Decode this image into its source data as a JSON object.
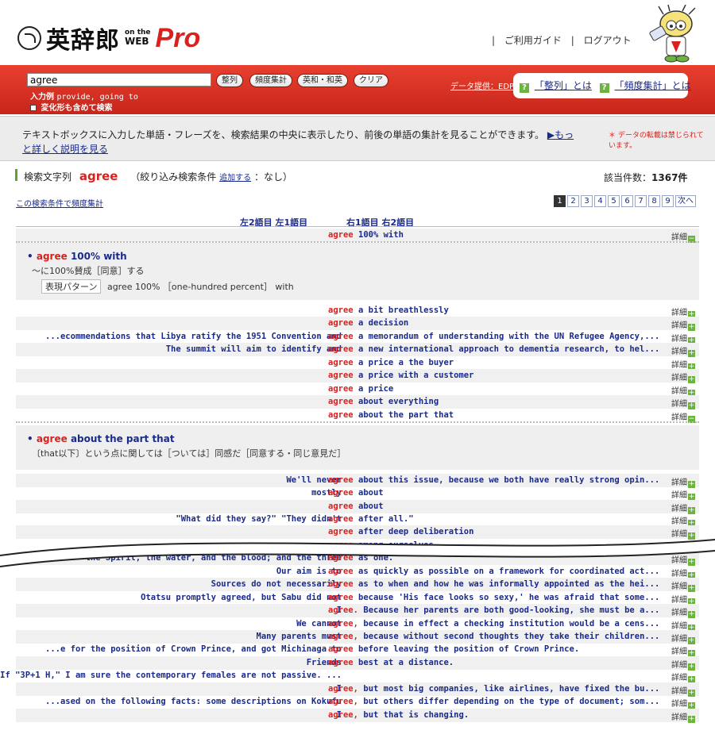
{
  "header": {
    "logo_name": "英辞郎",
    "logo_on_the": "on the",
    "logo_web": "WEB",
    "logo_pro": "Pro",
    "links": [
      "ご利用ガイド",
      "ログアウト"
    ]
  },
  "search": {
    "value": "agree",
    "buttons": [
      "整列",
      "頻度集計",
      "英和・和英",
      "クリア"
    ],
    "hint_label": "入力例",
    "hint_example": "provide, going to",
    "checkbox_label": "変化形も含めて検索",
    "data_provider": "データ提供：EDP",
    "help_links": [
      "「整列」とは",
      "「頻度集計」とは"
    ]
  },
  "info": {
    "text": "テキストボックスに入力した単語・フレーズを、検索結果の中央に表示したり、前後の単語の集計を見ることができます。",
    "more_link": "▶もっと詳しく説明を見る",
    "notice": "＊ データの転載は禁じられています。"
  },
  "results": {
    "label": "検索文字列",
    "term": "agree",
    "filter_prefix": "（絞り込み検索条件",
    "filter_link": "追加する",
    "filter_suffix": "：なし）",
    "hits_label": "該当件数：",
    "hits_value": "1367件",
    "freq_link": "この検索条件で頻度集計",
    "pages": [
      "1",
      "2",
      "3",
      "4",
      "5",
      "6",
      "7",
      "8",
      "9",
      "次へ"
    ],
    "col_left": "左2語目 左1語目",
    "col_right": "右1語目 右2語目",
    "detail_label": "詳細"
  },
  "entry1": {
    "keyword": "agree",
    "rest": "100% with",
    "meaning": "～に100%賛成［同意］する",
    "pattern_tag": "表現パターン",
    "pattern": "agree 100% ［one-hundred percent］ with"
  },
  "entry2": {
    "keyword": "agree",
    "rest": "about the part that",
    "meaning": "〔that以下〕という点に関しては［ついては］同感だ［同意する・同じ意見だ］"
  },
  "rows": [
    {
      "left": "",
      "kw": "agree",
      "right": "100% with"
    },
    {
      "left": "",
      "kw": "agree",
      "right": "a bit breathlessly"
    },
    {
      "left": "",
      "kw": "agree",
      "right": "a decision"
    },
    {
      "left": "...ecommendations that Libya ratify the 1951 Convention and",
      "kw": "agree",
      "right": "a memorandum of understanding with the UN Refugee Agency,..."
    },
    {
      "left": "The summit will aim to identify and",
      "kw": "agree",
      "right": "a new international approach to dementia research, to hel..."
    },
    {
      "left": "",
      "kw": "agree",
      "right": "a price a the buyer"
    },
    {
      "left": "",
      "kw": "agree",
      "right": "a price with a customer"
    },
    {
      "left": "",
      "kw": "agree",
      "right": "a price"
    },
    {
      "left": "",
      "kw": "agree",
      "right": "about everything"
    },
    {
      "left": "",
      "kw": "agree",
      "right": "about the part that"
    },
    {
      "left": "We'll never",
      "kw": "agree",
      "right": "about this issue, because we both have really strong opin..."
    },
    {
      "left": "mostly",
      "kw": "agree",
      "right": "about"
    },
    {
      "left": "",
      "kw": "agree",
      "right": "about"
    },
    {
      "left": "\"What did they say?\" \"They didn't",
      "kw": "agree",
      "right": "after all.\""
    },
    {
      "left": "",
      "kw": "agree",
      "right": "after deep deliberation"
    },
    {
      "left": "",
      "kw": "agree",
      "right": "among ourselves"
    },
    {
      "left": "the Spirit, the water, and the blood; and the three",
      "kw": "agree",
      "right": "as one."
    },
    {
      "left": "Our aim is to",
      "kw": "agree",
      "right": "as quickly as possible on a framework for coordinated act..."
    },
    {
      "left": "Sources do not necessarily",
      "kw": "agree",
      "right": "as to when and how he was informally appointed as the hei..."
    },
    {
      "left": "Otatsu promptly agreed, but Sabu did not",
      "kw": "agree",
      "right": "because 'His face looks so sexy,' he was afraid that some..."
    },
    {
      "left": "I",
      "kw": "agree.",
      "right": "Because her parents are both good-looking, she must be a..."
    },
    {
      "left": "We cannot",
      "kw": "agree,",
      "right": "because in effect a checking institution would be a cens..."
    },
    {
      "left": "Many parents must",
      "kw": "agree,",
      "right": "because without second thoughts they take their children..."
    },
    {
      "left": "...e for the position of Crown Prince, and got Michinaga to",
      "kw": "agree",
      "right": "before leaving the position of Crown Prince."
    },
    {
      "left": "Friends",
      "kw": "agree",
      "right": "best at a distance."
    },
    {
      "left": "If \"3P+1 H,\" I am sure the contemporary females are not passive. ...",
      "kw": "",
      "right": ""
    },
    {
      "left": "I",
      "kw": "agree,",
      "right": "but most big companies, like airlines, have fixed the bu..."
    },
    {
      "left": "...ased on the following facts: some descriptions on Kokufu",
      "kw": "agree,",
      "right": "but others differ depending on the type of document; som..."
    },
    {
      "left": "I",
      "kw": "agree,",
      "right": "but that is changing."
    }
  ]
}
